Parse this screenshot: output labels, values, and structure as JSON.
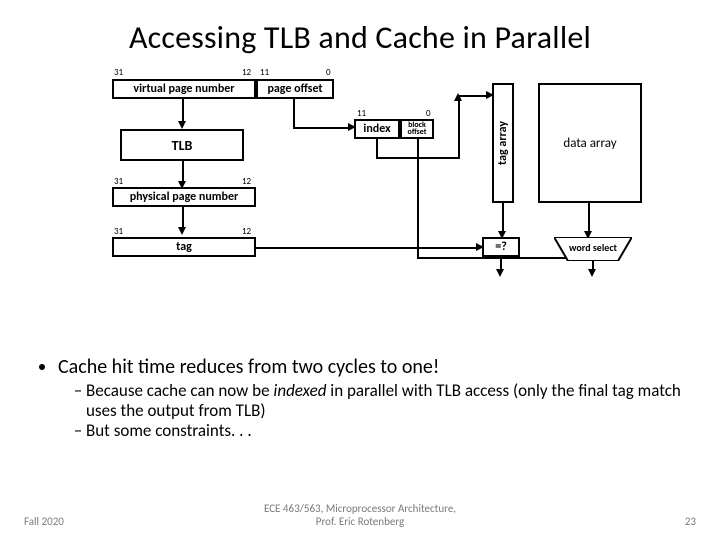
{
  "title": "Accessing TLB and Cache in Parallel",
  "bits": {
    "b31a": "31",
    "b12a": "12",
    "b11a": "11",
    "b0a": "0",
    "b11b": "11",
    "b0b": "0",
    "b31b": "31",
    "b12b": "12",
    "b31c": "31",
    "b12c": "12"
  },
  "labels": {
    "vpn": "virtual page number",
    "poff": "page offset",
    "tlb": "TLB",
    "index": "index",
    "boff_top": "block",
    "boff_bot": "offset",
    "ppn": "physical page number",
    "tag": "tag",
    "tagarr": "tag array",
    "dataarr": "data array",
    "eq": "=?",
    "wsel": "word select"
  },
  "bullets": {
    "main": "Cache hit time reduces from two cycles to one!",
    "sub1a": "Because cache can now be ",
    "sub1b": "indexed",
    "sub1c": " in parallel with TLB access (only the final tag match uses the output from TLB)",
    "sub2": "But some constraints. . ."
  },
  "footer": {
    "left": "Fall 2020",
    "center1": "ECE 463/563, Microprocessor Architecture,",
    "center2": "Prof. Eric Rotenberg",
    "right": "23"
  }
}
